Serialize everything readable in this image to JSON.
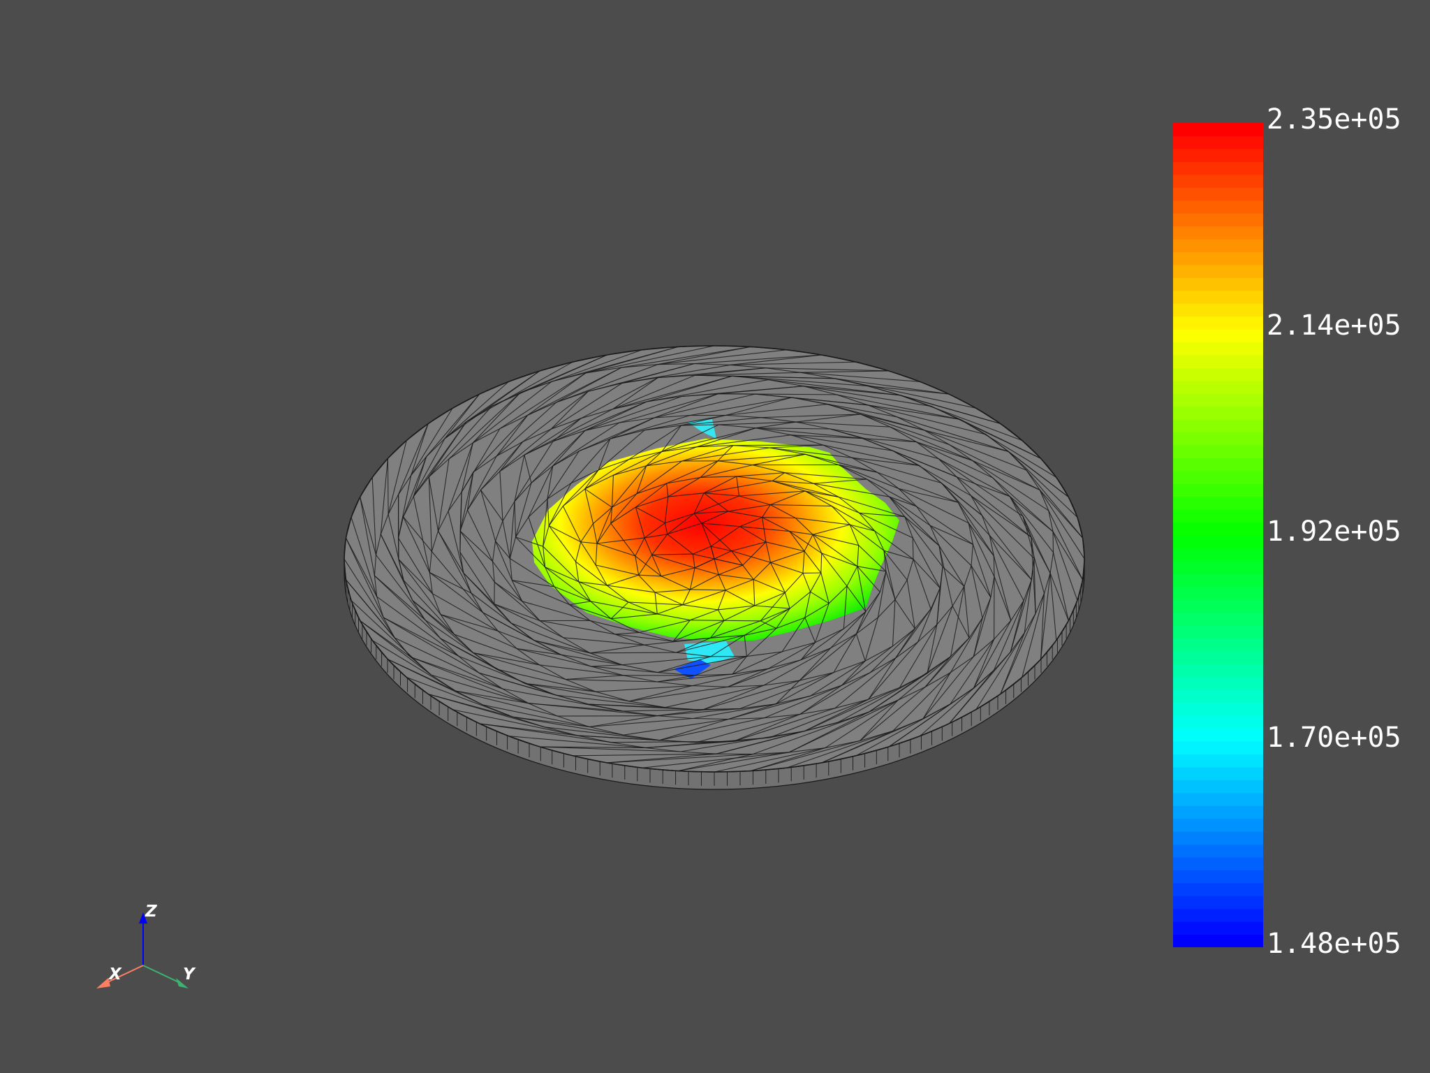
{
  "viewer": {
    "background": "#4c4c4c",
    "mesh_color": "#808080",
    "mesh_edge_color": "#1a1a1a"
  },
  "colorbar": {
    "max": 235000,
    "min": 148000,
    "colors": [
      "#0000ff",
      "#00ffff",
      "#00ff00",
      "#ffff00",
      "#ff0000"
    ],
    "labels": [
      {
        "text": "2.35e+05",
        "value": 235000
      },
      {
        "text": "2.14e+05",
        "value": 214000
      },
      {
        "text": "1.92e+05",
        "value": 192000
      },
      {
        "text": "1.70e+05",
        "value": 170000
      },
      {
        "text": "1.48e+05",
        "value": 148000
      }
    ]
  },
  "axes": {
    "x": {
      "label": "X",
      "color": "#ff7f64"
    },
    "y": {
      "label": "Y",
      "color": "#3cb371"
    },
    "z": {
      "label": "Z",
      "color": "#0000ff"
    }
  }
}
